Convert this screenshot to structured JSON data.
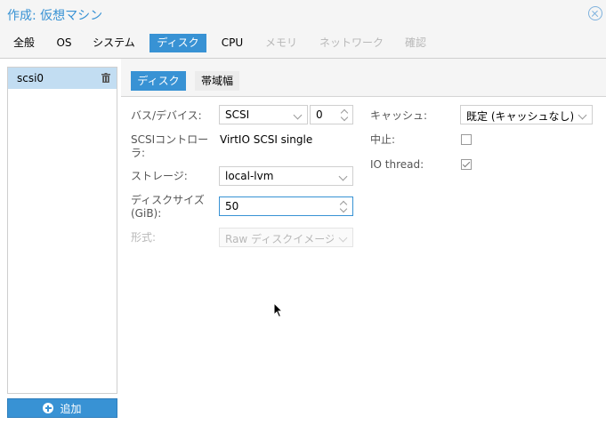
{
  "window": {
    "title": "作成: 仮想マシン",
    "close_icon": "close-circle-icon"
  },
  "tabs": [
    {
      "label": "全般",
      "state": "normal"
    },
    {
      "label": "OS",
      "state": "normal"
    },
    {
      "label": "システム",
      "state": "normal"
    },
    {
      "label": "ディスク",
      "state": "active"
    },
    {
      "label": "CPU",
      "state": "normal"
    },
    {
      "label": "メモリ",
      "state": "disabled"
    },
    {
      "label": "ネットワーク",
      "state": "disabled"
    },
    {
      "label": "確認",
      "state": "disabled"
    }
  ],
  "disk_list": {
    "items": [
      {
        "label": "scsi0",
        "icon": "trash-icon"
      }
    ],
    "add_button": {
      "label": "追加",
      "icon": "plus-circle-icon"
    }
  },
  "subtabs": [
    {
      "label": "ディスク",
      "state": "active"
    },
    {
      "label": "帯域幅",
      "state": "inactive"
    }
  ],
  "form": {
    "bus_device": {
      "label": "バス/デバイス:",
      "bus_value": "SCSI",
      "device_value": "0"
    },
    "controller": {
      "label_line1": "SCSIコントロー",
      "label_line2": "ラ:",
      "value": "VirtIO SCSI single"
    },
    "storage": {
      "label": "ストレージ:",
      "value": "local-lvm"
    },
    "disk_size": {
      "label_line1": "ディスクサイズ",
      "label_line2": "(GiB):",
      "value": "50"
    },
    "format": {
      "label": "形式:",
      "value": "Raw ディスクイメージ"
    },
    "cache": {
      "label": "キャッシュ:",
      "value": "既定 (キャッシュなし)"
    },
    "discard": {
      "label": "中止:",
      "checked": false
    },
    "io_thread": {
      "label": "IO thread:",
      "checked": true
    }
  },
  "colors": {
    "accent": "#3892d4",
    "selected_row": "#c2ddf2",
    "panel_bg": "#f5f5f5",
    "disabled_text": "#b8b8b8"
  }
}
